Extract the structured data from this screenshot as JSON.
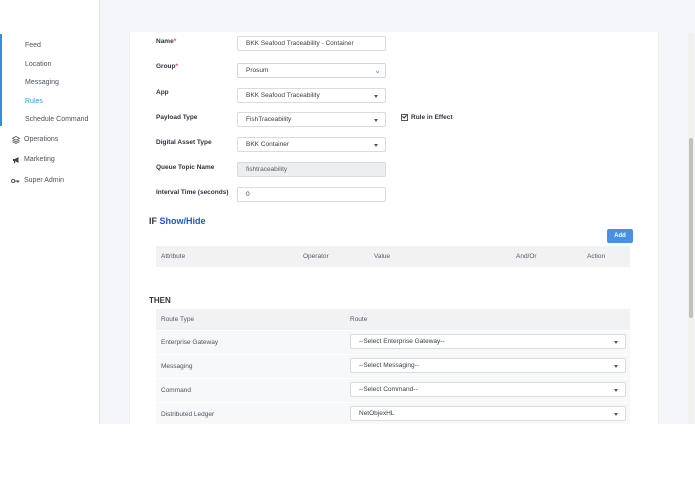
{
  "sidebar": {
    "subitems": [
      {
        "label": "Feed"
      },
      {
        "label": "Location"
      },
      {
        "label": "Messaging"
      },
      {
        "label": "Rules"
      },
      {
        "label": "Schedule Command"
      }
    ],
    "main_items": [
      {
        "label": "Operations",
        "icon": "layers-icon"
      },
      {
        "label": "Marketing",
        "icon": "megaphone-icon"
      },
      {
        "label": "Super Admin",
        "icon": "key-icon"
      }
    ],
    "active_color": "#2f9be6"
  },
  "form": {
    "name_label": "Name",
    "name_value": "BKK Seafood Traceability - Container",
    "group_label": "Group",
    "group_value": "Prosum",
    "app_label": "App",
    "app_value": "BKK Seafood Traceability",
    "payload_label": "Payload Type",
    "payload_value": "FishTraceability",
    "rule_in_effect_label": "Rule in Effect",
    "rule_in_effect_checked": true,
    "dat_label": "Digital Asset Type",
    "dat_value": "BKK Container",
    "qtn_label": "Queue Topic Name",
    "qtn_value": "fishtraceability",
    "interval_label": "Interval Time (seconds)",
    "interval_value": "0",
    "required_mark": "*"
  },
  "if_section": {
    "prefix": "IF",
    "link": "Show/Hide",
    "add_label": "Add",
    "columns": [
      "Attribute",
      "Operator",
      "Value",
      "And/Or",
      "Action"
    ]
  },
  "then_section": {
    "title": "THEN",
    "columns": [
      "Route Type",
      "Route"
    ],
    "rows": [
      {
        "type": "Enterprise Gateway",
        "route": "--Select Enterprise Gateway--"
      },
      {
        "type": "Messaging",
        "route": "--Select Messaging--"
      },
      {
        "type": "Command",
        "route": "--Select Command--"
      },
      {
        "type": "Distributed Ledger",
        "route": "NetObjexHL"
      }
    ]
  },
  "colors": {
    "accent": "#4a90e2",
    "link": "#1f55c8",
    "required": "#e5484d"
  }
}
